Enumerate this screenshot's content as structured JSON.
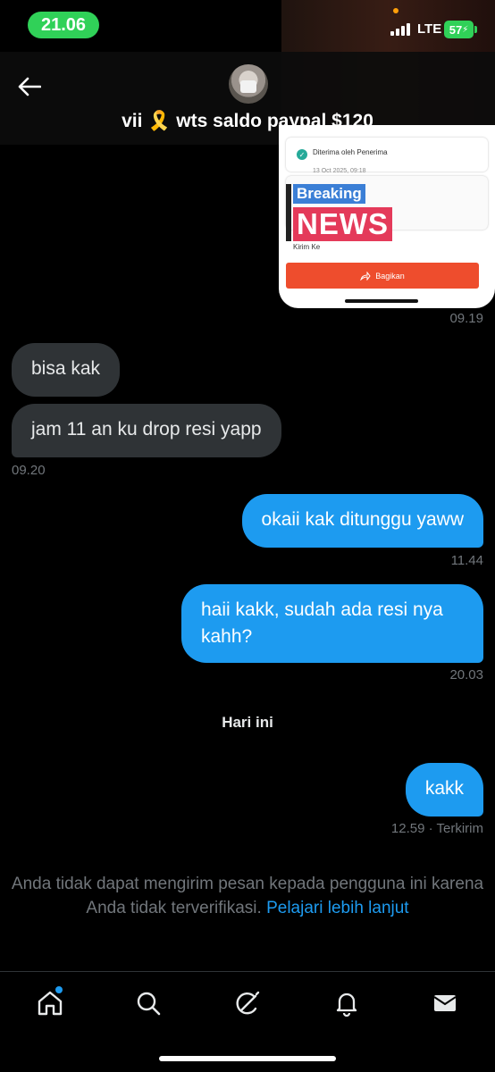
{
  "status_bar": {
    "time": "21.06",
    "network": "LTE",
    "battery": "57"
  },
  "header": {
    "title_prefix": "vii",
    "ribbon_emoji": "🎗️",
    "title_suffix": "wts saldo paypal $120"
  },
  "shared_image": {
    "received_label": "Diterima oleh Penerima",
    "received_date": "13 Oct 2025, 09:18",
    "stamp_top": "Breaking",
    "stamp_bottom": "NEWS",
    "send_to_label": "Kirim Ke",
    "share_button": "Bagikan"
  },
  "messages": [
    {
      "direction": "out",
      "type": "image",
      "time": "09.19"
    },
    {
      "direction": "in",
      "text": "bisa kak"
    },
    {
      "direction": "in",
      "text": "jam 11 an ku drop resi yapp",
      "time": "09.20"
    },
    {
      "direction": "out",
      "text": "okaii kak ditunggu yaww",
      "time": "11.44"
    },
    {
      "direction": "out",
      "text": "haii kakk, sudah ada resi nya kahh?",
      "time": "20.03"
    },
    {
      "direction": "out",
      "text": "kakk",
      "time": "12.59 · Terkirim"
    }
  ],
  "day_separator": "Hari ini",
  "notice": {
    "text": "Anda tidak dapat mengirim pesan kepada pengguna ini karena Anda tidak terverifikasi.",
    "link": "Pelajari lebih lanjut"
  },
  "bottom_nav": [
    "home-icon",
    "search-icon",
    "grok-icon",
    "bell-icon",
    "mail-icon"
  ],
  "colors": {
    "accent": "#1d9bf0",
    "incoming_bubble": "#2f3336",
    "status_green": "#30d158",
    "muted_text": "#71767b"
  }
}
